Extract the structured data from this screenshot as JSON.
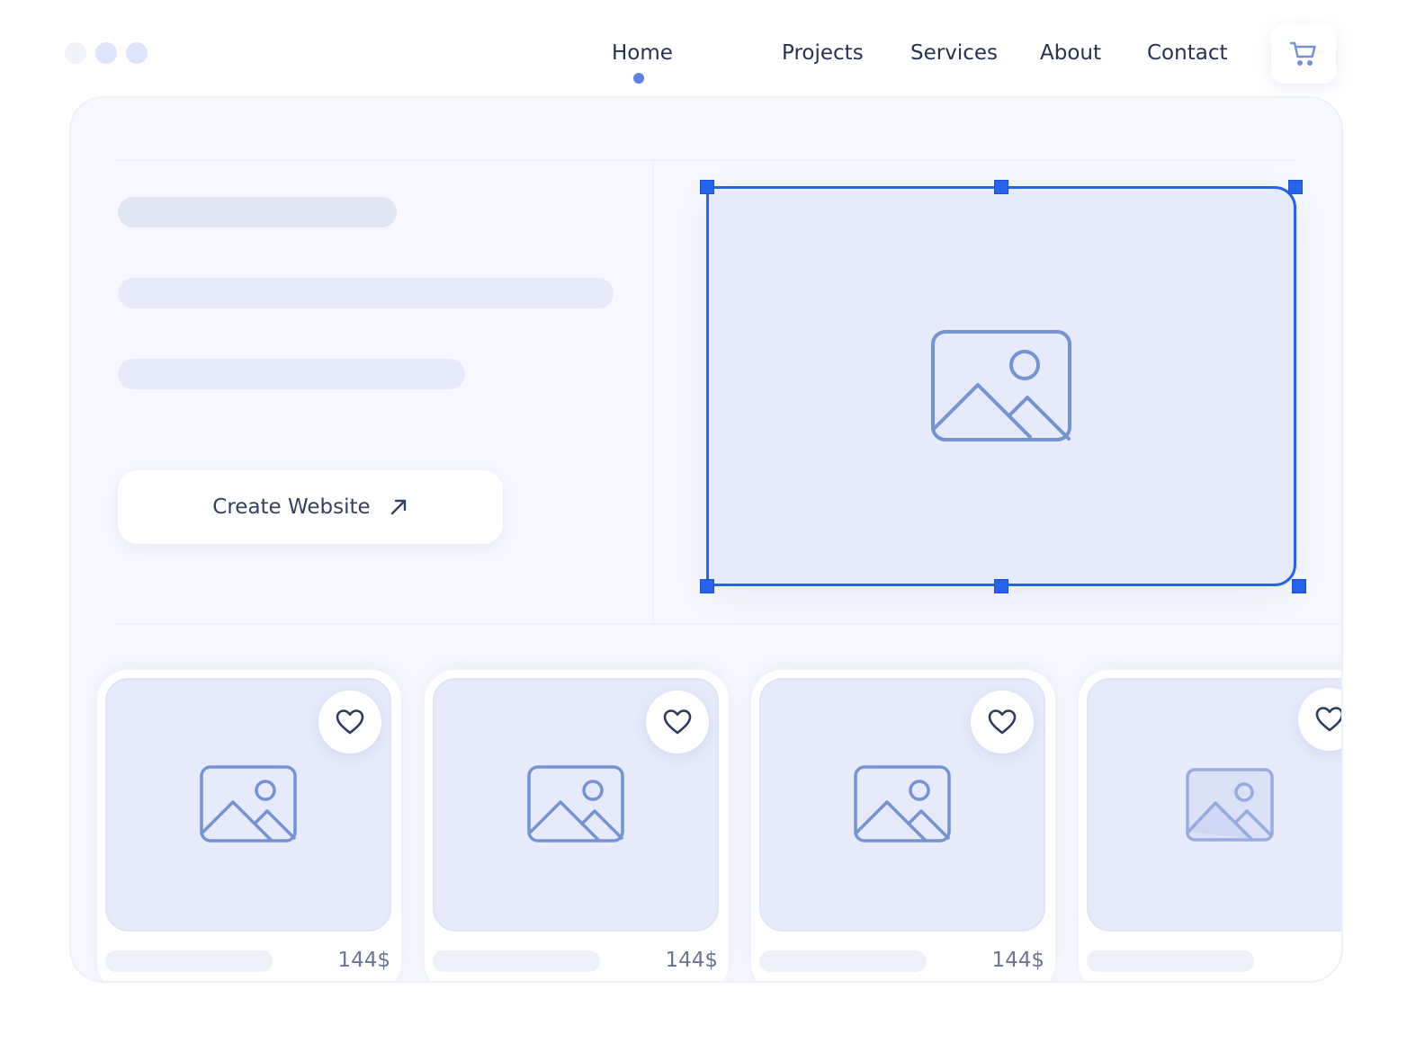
{
  "nav": {
    "items": [
      {
        "label": "Home",
        "active": true
      },
      {
        "label": "Projects"
      },
      {
        "label": "Services"
      },
      {
        "label": "About"
      },
      {
        "label": "Contact"
      }
    ],
    "cart_icon": "shopping-cart-icon"
  },
  "hero": {
    "cta_label": "Create Website",
    "cta_icon": "arrow-up-right-icon",
    "image_icon": "image-placeholder-icon"
  },
  "products": [
    {
      "price": "144$",
      "icon": "heart-icon"
    },
    {
      "price": "144$",
      "icon": "heart-icon"
    },
    {
      "price": "144$",
      "icon": "heart-icon"
    },
    {
      "price": "",
      "icon": "heart-icon"
    }
  ],
  "colors": {
    "accent": "#2563eb",
    "active_dot": "#5b82e6",
    "icon_stroke": "#7393d3",
    "placeholder_bg": "#e6eafb",
    "text": "#26324f"
  }
}
